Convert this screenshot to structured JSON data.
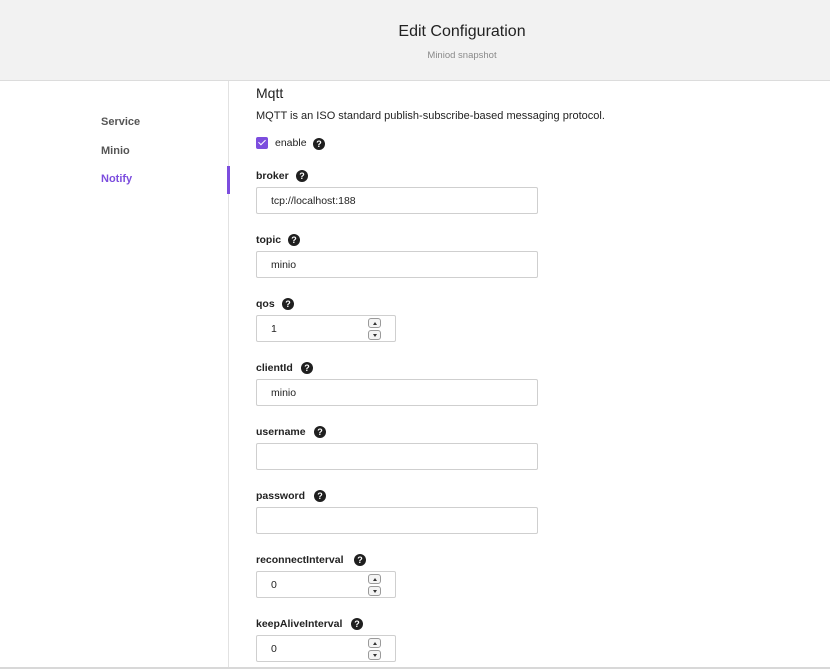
{
  "header": {
    "title": "Edit Configuration",
    "subtitle": "Miniod snapshot"
  },
  "sidebar": {
    "items": [
      {
        "label": "Service",
        "active": false
      },
      {
        "label": "Minio",
        "active": false
      },
      {
        "label": "Notify",
        "active": true
      }
    ]
  },
  "section": {
    "title": "Mqtt",
    "description": "MQTT is an ISO standard publish-subscribe-based messaging protocol.",
    "enable": {
      "label": "enable",
      "checked": true
    }
  },
  "help_icon": "?",
  "fields": {
    "broker": {
      "label": "broker",
      "value": "tcp://localhost:188"
    },
    "topic": {
      "label": "topic",
      "value": "minio"
    },
    "qos": {
      "label": "qos",
      "value": "1"
    },
    "clientId": {
      "label": "clientId",
      "value": "minio"
    },
    "username": {
      "label": "username",
      "value": ""
    },
    "password": {
      "label": "password",
      "value": ""
    },
    "reconnectInterval": {
      "label": "reconnectInterval",
      "value": "0"
    },
    "keepAliveInterval": {
      "label": "keepAliveInterval",
      "value": "0"
    }
  },
  "colors": {
    "accent": "#7c4dde",
    "header_bg": "#f2f2f2",
    "help_bg": "#1f1f1f"
  }
}
